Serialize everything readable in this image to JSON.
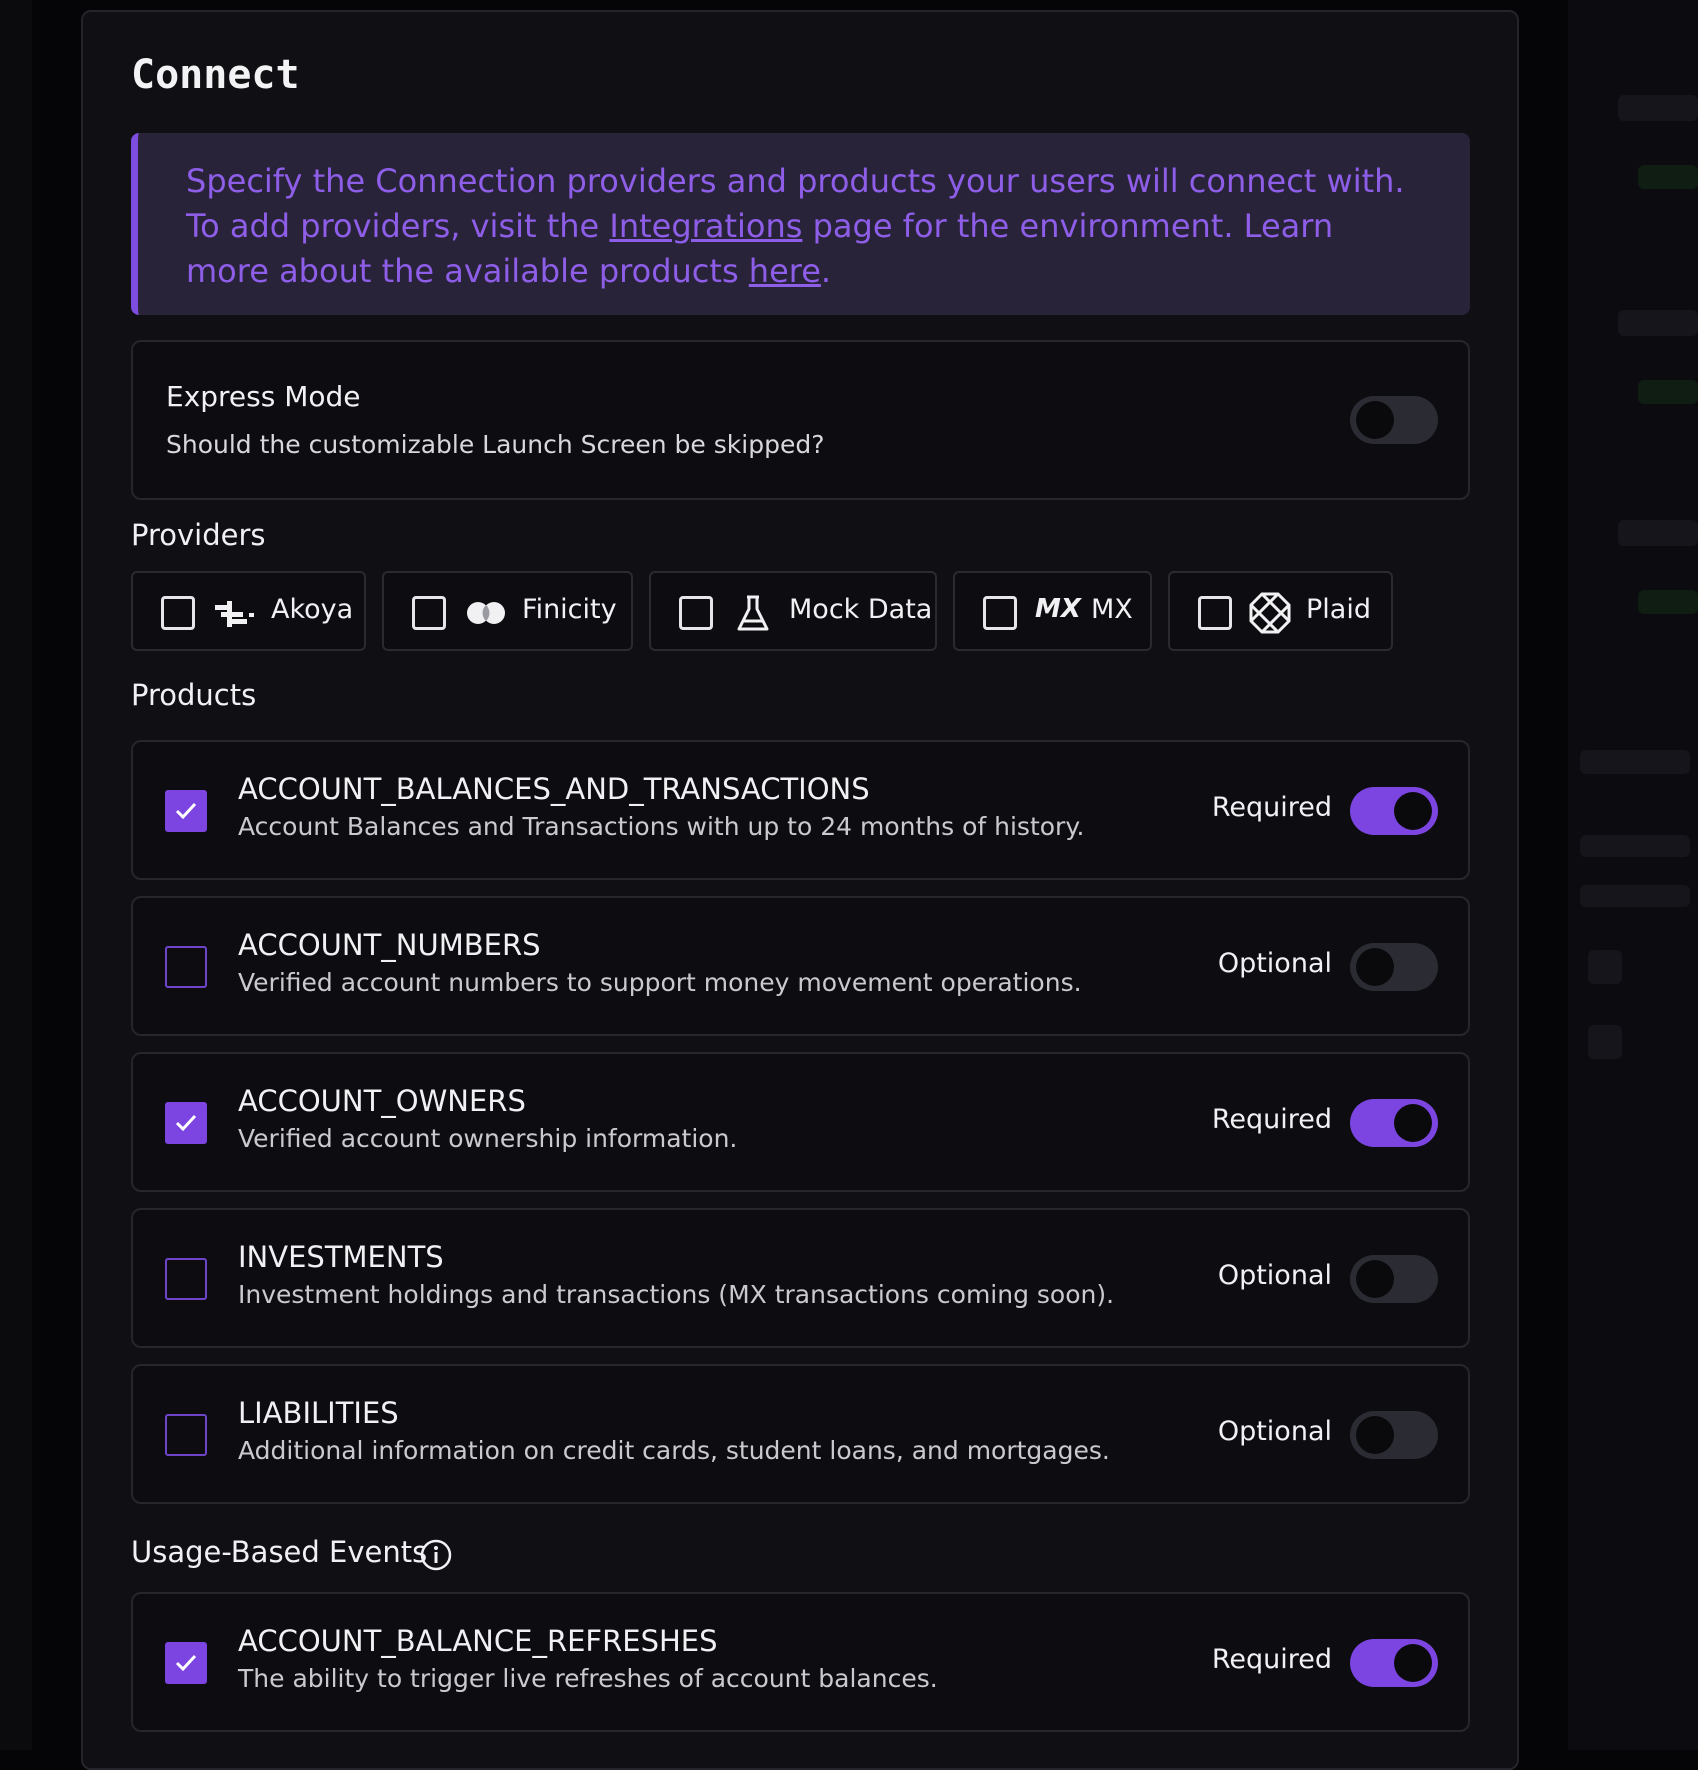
{
  "panel": {
    "title": "Connect"
  },
  "banner": {
    "text_1": "Specify the Connection providers and products your users will connect with. To add providers, visit the ",
    "link_integrations": "Integrations",
    "text_2": " page for the environment. Learn more about the available products ",
    "link_here": "here",
    "text_3": "."
  },
  "express_mode": {
    "title": "Express Mode",
    "description": "Should the customizable Launch Screen be skipped?",
    "enabled": false
  },
  "providers": {
    "label": "Providers",
    "items": [
      {
        "label": "Akoya",
        "icon": "akoya-logo-icon",
        "checked": false
      },
      {
        "label": "Finicity",
        "icon": "finicity-logo-icon",
        "checked": false
      },
      {
        "label": "Mock Data",
        "icon": "flask-icon",
        "checked": false
      },
      {
        "label": "MX",
        "icon": "mx-logo-icon",
        "logo_text": "MX",
        "checked": false
      },
      {
        "label": "Plaid",
        "icon": "plaid-logo-icon",
        "checked": false
      }
    ]
  },
  "products": {
    "label": "Products",
    "items": [
      {
        "name": "ACCOUNT_BALANCES_AND_TRANSACTIONS",
        "description": "Account Balances and Transactions with up to 24 months of history.",
        "checked": true,
        "requirement": "Required",
        "required": true
      },
      {
        "name": "ACCOUNT_NUMBERS",
        "description": "Verified account numbers to support money movement operations.",
        "checked": false,
        "requirement": "Optional",
        "required": false
      },
      {
        "name": "ACCOUNT_OWNERS",
        "description": "Verified account ownership information.",
        "checked": true,
        "requirement": "Required",
        "required": true
      },
      {
        "name": "INVESTMENTS",
        "description": "Investment holdings and transactions (MX transactions coming soon).",
        "checked": false,
        "requirement": "Optional",
        "required": false
      },
      {
        "name": "LIABILITIES",
        "description": "Additional information on credit cards, student loans, and mortgages.",
        "checked": false,
        "requirement": "Optional",
        "required": false
      }
    ]
  },
  "usage_events": {
    "label": "Usage-Based Events",
    "icon": "info-icon",
    "items": [
      {
        "name": "ACCOUNT_BALANCE_REFRESHES",
        "description": "The ability to trigger live refreshes of account balances.",
        "checked": true,
        "requirement": "Required",
        "required": true
      }
    ]
  },
  "colors": {
    "accent": "#7c45e2",
    "banner_text": "#8e5ee8",
    "banner_bg": "#29233a",
    "panel_bg": "#0f0f14"
  }
}
